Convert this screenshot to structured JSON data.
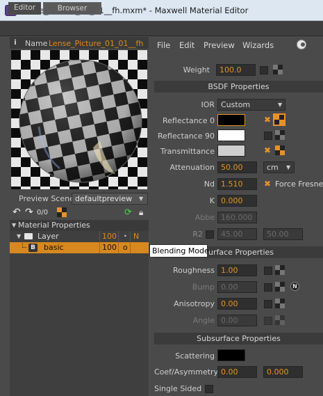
{
  "window": {
    "title": "Lense_Picture_01_01__fh.mxm* - Maxwell Material Editor"
  },
  "tabs": {
    "editor": "Editor",
    "browser": "Browser"
  },
  "material": {
    "name_label": "Name",
    "name_value": "Lense_Picture_01_01__fh"
  },
  "preview": {
    "scene_label": "Preview Scene",
    "scene_value": "defaultpreview",
    "counter": "0/0"
  },
  "tree": {
    "header": {
      "label": "Material Properties"
    },
    "layer": {
      "label": "Layer",
      "value": "100",
      "mode": "N"
    },
    "bsdf": {
      "badge": "B",
      "label": "basic",
      "value": "100",
      "mode": "o"
    }
  },
  "menu": {
    "file": "File",
    "edit": "Edit",
    "preview": "Preview",
    "wizards": "Wizards"
  },
  "props": {
    "weight_label": "Weight",
    "weight_value": "100.0",
    "bsdf_section": "BSDF Properties",
    "ior_label": "IOR",
    "ior_value": "Custom",
    "refl0_label": "Reflectance 0",
    "refl90_label": "Reflectance 90",
    "trans_label": "Transmittance",
    "atten_label": "Attenuation",
    "atten_value": "50.00",
    "atten_unit": "cm",
    "nd_label": "Nd",
    "nd_value": "1.510",
    "force_fresnel": "Force Fresnel",
    "k_label": "K",
    "k_value": "0.000",
    "abbe_label": "Abbe",
    "abbe_value": "160.000",
    "r2_label": "R2",
    "r2_value1": "45.00",
    "r2_value2": "50.00",
    "surface_section": "Surface Properties",
    "roughness_label": "Roughness",
    "roughness_value": "1.00",
    "bump_label": "Bump",
    "bump_value": "0.00",
    "aniso_label": "Anisotropy",
    "aniso_value": "0.00",
    "angle_label": "Angle",
    "angle_value": "0.00",
    "subsurface_section": "Subsurface Properties",
    "scattering_label": "Scattering",
    "coef_label": "Coef/Asymmetry",
    "coef_value": "0.00",
    "asym_value": "0.000",
    "single_sided_label": "Single Sided"
  },
  "tooltip": {
    "text": "Blending Mode"
  },
  "colors": {
    "accent": "#e08a1a",
    "selected_row": "#d7881f",
    "panel": "#4a4a4a"
  }
}
